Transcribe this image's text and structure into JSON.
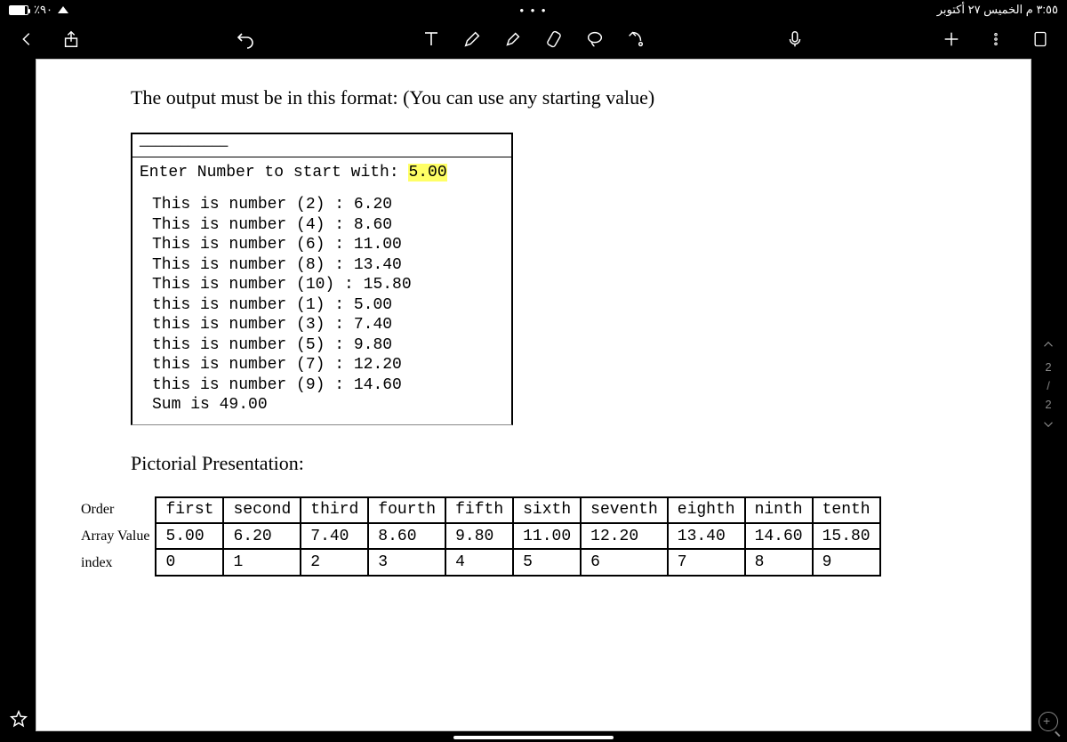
{
  "status": {
    "battery_pct": "٪٩٠",
    "datetime": "٣:٥٥ م  الخميس ٢٧ أكتوبر"
  },
  "doc": {
    "heading": "The output must be in this format: (You can use any starting value)",
    "console_top": "ـــــــــــ",
    "prompt_label": "Enter Number to start with: ",
    "prompt_value": "5.00",
    "lines": [
      "This is number (2) : 6.20",
      "This is number (4) : 8.60",
      "This is number (6) : 11.00",
      "This is number (8) : 13.40",
      "This is number (10) : 15.80",
      "this is number (1) : 5.00",
      "this is number (3) : 7.40",
      "this is number (5) : 9.80",
      "this is number (7) : 12.20",
      "this is number (9) : 14.60",
      "Sum is 49.00"
    ],
    "pictorial": "Pictorial Presentation:",
    "row_labels": [
      "Order",
      "Array Value",
      "index"
    ],
    "table": {
      "r1": [
        "first",
        "second",
        "third",
        "fourth",
        "fifth",
        "sixth",
        "seventh",
        "eighth",
        "ninth",
        "tenth"
      ],
      "r2": [
        "5.00",
        "6.20",
        "7.40",
        "8.60",
        "9.80",
        "11.00",
        "12.20",
        "13.40",
        "14.60",
        "15.80"
      ],
      "r3": [
        "0",
        "1",
        "2",
        "3",
        "4",
        "5",
        "6",
        "7",
        "8",
        "9"
      ]
    }
  },
  "pager": {
    "current": "2",
    "sep": "/",
    "total": "2"
  }
}
